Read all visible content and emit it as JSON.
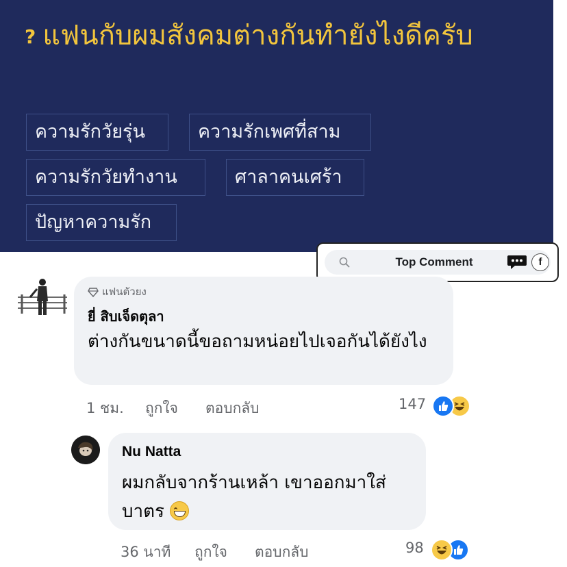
{
  "forum": {
    "title_prefix": "?",
    "title": "แฟนกับผมสังคมต่างกันทำยังไงดีครับ",
    "tags": [
      "ความรักวัยรุ่น",
      "ความรักเพศที่สาม",
      "ความรักวัยทำงาน",
      "ศาลาคนเศร้า",
      "ปัญหาความรัก"
    ]
  },
  "top_comment_bar": {
    "label": "Top Comment",
    "icons": [
      "search-icon",
      "chat-icon",
      "facebook-icon"
    ]
  },
  "comments": [
    {
      "badge": "แฟนตัวยง",
      "author": "ยี่ สิบเจ็ดตุลา",
      "text": "ต่างกันขนาดนี้ขอถามหน่อยไปเจอกันได้ยังไง",
      "time": "1 ชม.",
      "like_action": "ถูกใจ",
      "reply_action": "ตอบกลับ",
      "reaction_count": "147",
      "reactions": [
        "like",
        "haha"
      ]
    },
    {
      "author": "Nu Natta",
      "text": "ผมกลับจากร้านเหล้า เขาออกมาใส่บาตร",
      "emoji": "grinning-face",
      "time": "36 นาที",
      "like_action": "ถูกใจ",
      "reply_action": "ตอบกลับ",
      "reaction_count": "98",
      "reactions": [
        "haha",
        "like"
      ]
    }
  ],
  "colors": {
    "panel_bg": "#1f2a5c",
    "title_yellow": "#f2c53d",
    "tag_border": "#3e5088",
    "bubble_bg": "#f0f2f5",
    "like_blue": "#1877f2",
    "meta_gray": "#65676b"
  }
}
